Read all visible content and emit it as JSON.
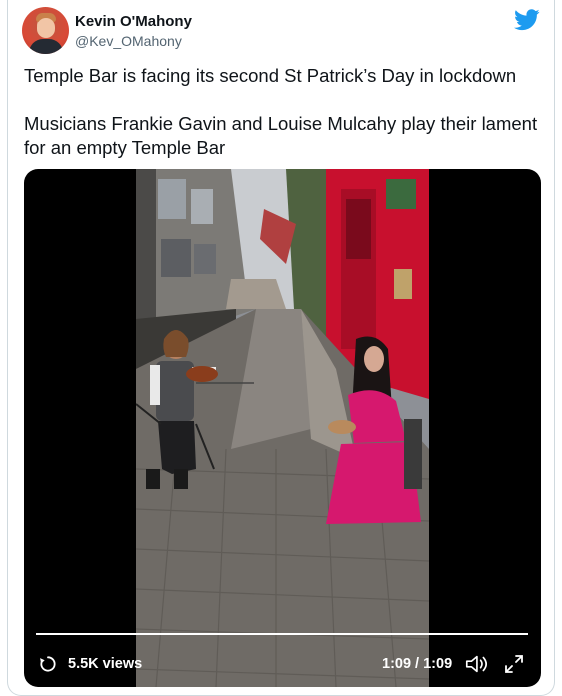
{
  "tweet": {
    "author_name": "Kevin O'Mahony",
    "author_handle": "@Kev_OMahony",
    "paragraph_1": "Temple Bar is facing its second St Patrick’s Day in lockdown",
    "paragraph_2": "Musicians Frankie Gavin and Louise Mulcahy play their lament for an empty Temple Bar"
  },
  "video": {
    "views": "5.5K views",
    "time": "1:09 / 1:09",
    "progress_fraction": 1.0
  },
  "icons": {
    "platform": "twitter-bird-icon",
    "replay": "replay-icon",
    "volume": "volume-icon",
    "fullscreen": "fullscreen-icon"
  },
  "colors": {
    "brand_blue": "#1d9bf0",
    "text_primary": "#0f1419",
    "text_secondary": "#536471",
    "pub_red": "#c8102e",
    "dress_pink": "#d6186e"
  }
}
